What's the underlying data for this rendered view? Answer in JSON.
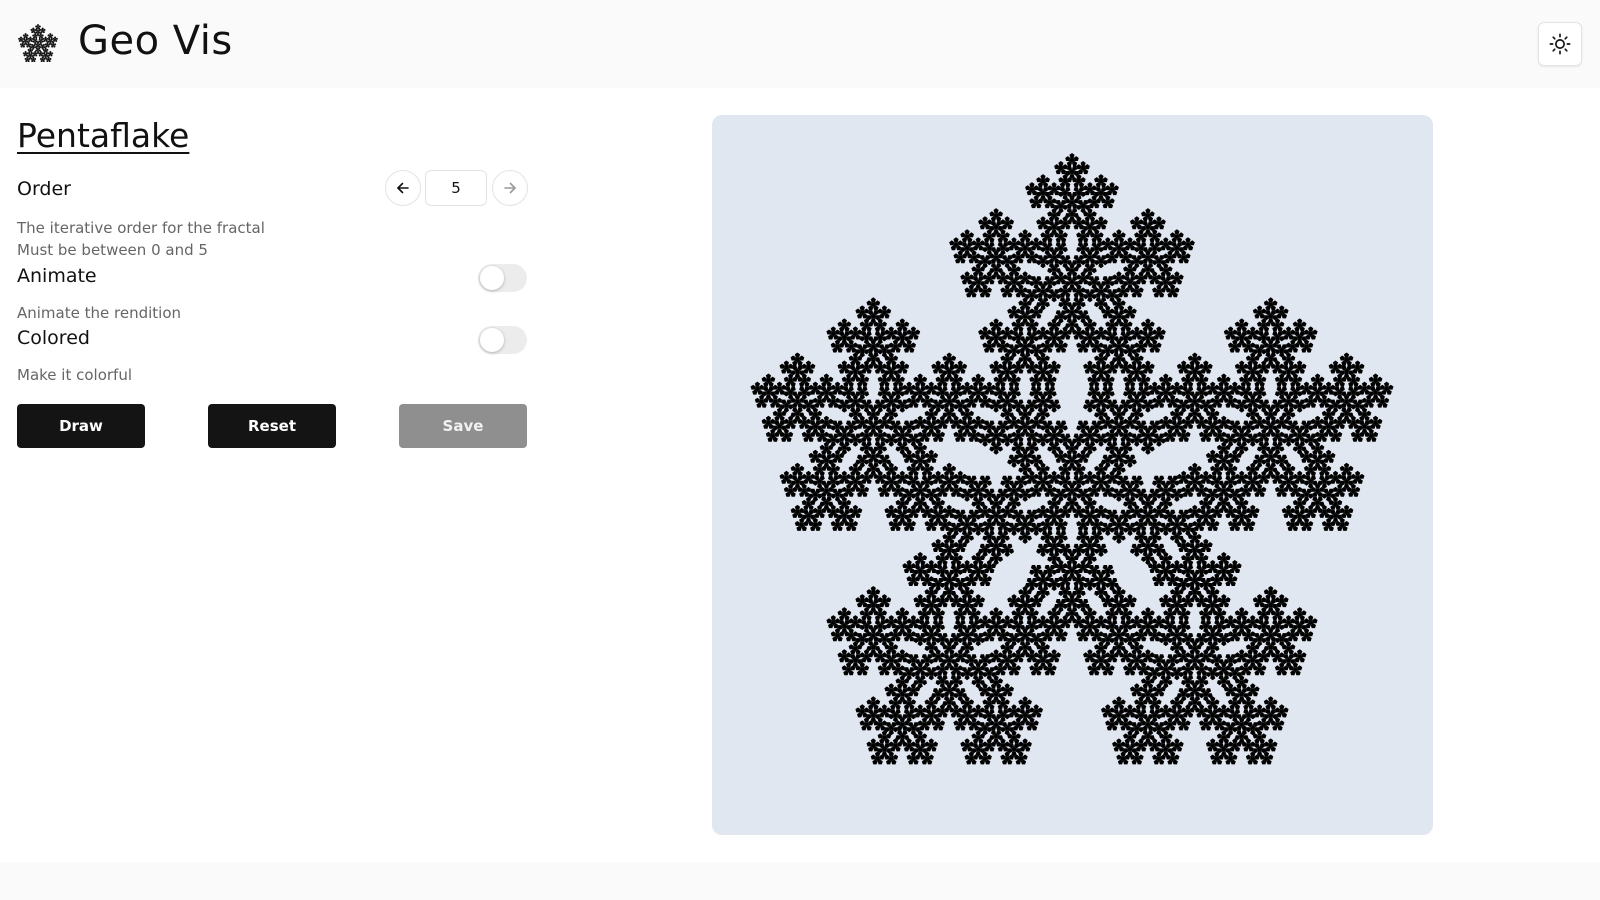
{
  "header": {
    "title": "Geo Vis",
    "logo_icon": "snowflake-fractal-icon",
    "theme_icon": "sun-icon"
  },
  "page": {
    "title": "Pentaflake"
  },
  "controls": {
    "order": {
      "label": "Order",
      "value": "5",
      "description_line1": "The iterative order for the fractal",
      "description_line2": "Must be between 0 and 5",
      "prev_icon": "arrow-left-icon",
      "next_icon": "arrow-right-icon"
    },
    "animate": {
      "label": "Animate",
      "description": "Animate the rendition",
      "enabled": false
    },
    "colored": {
      "label": "Colored",
      "description": "Make it colorful",
      "enabled": false
    }
  },
  "buttons": {
    "draw": "Draw",
    "reset": "Reset",
    "save": "Save"
  },
  "canvas": {
    "fractal": "pentaflake",
    "order": 5,
    "background": "#e1e7f0",
    "fill": "#000000"
  }
}
